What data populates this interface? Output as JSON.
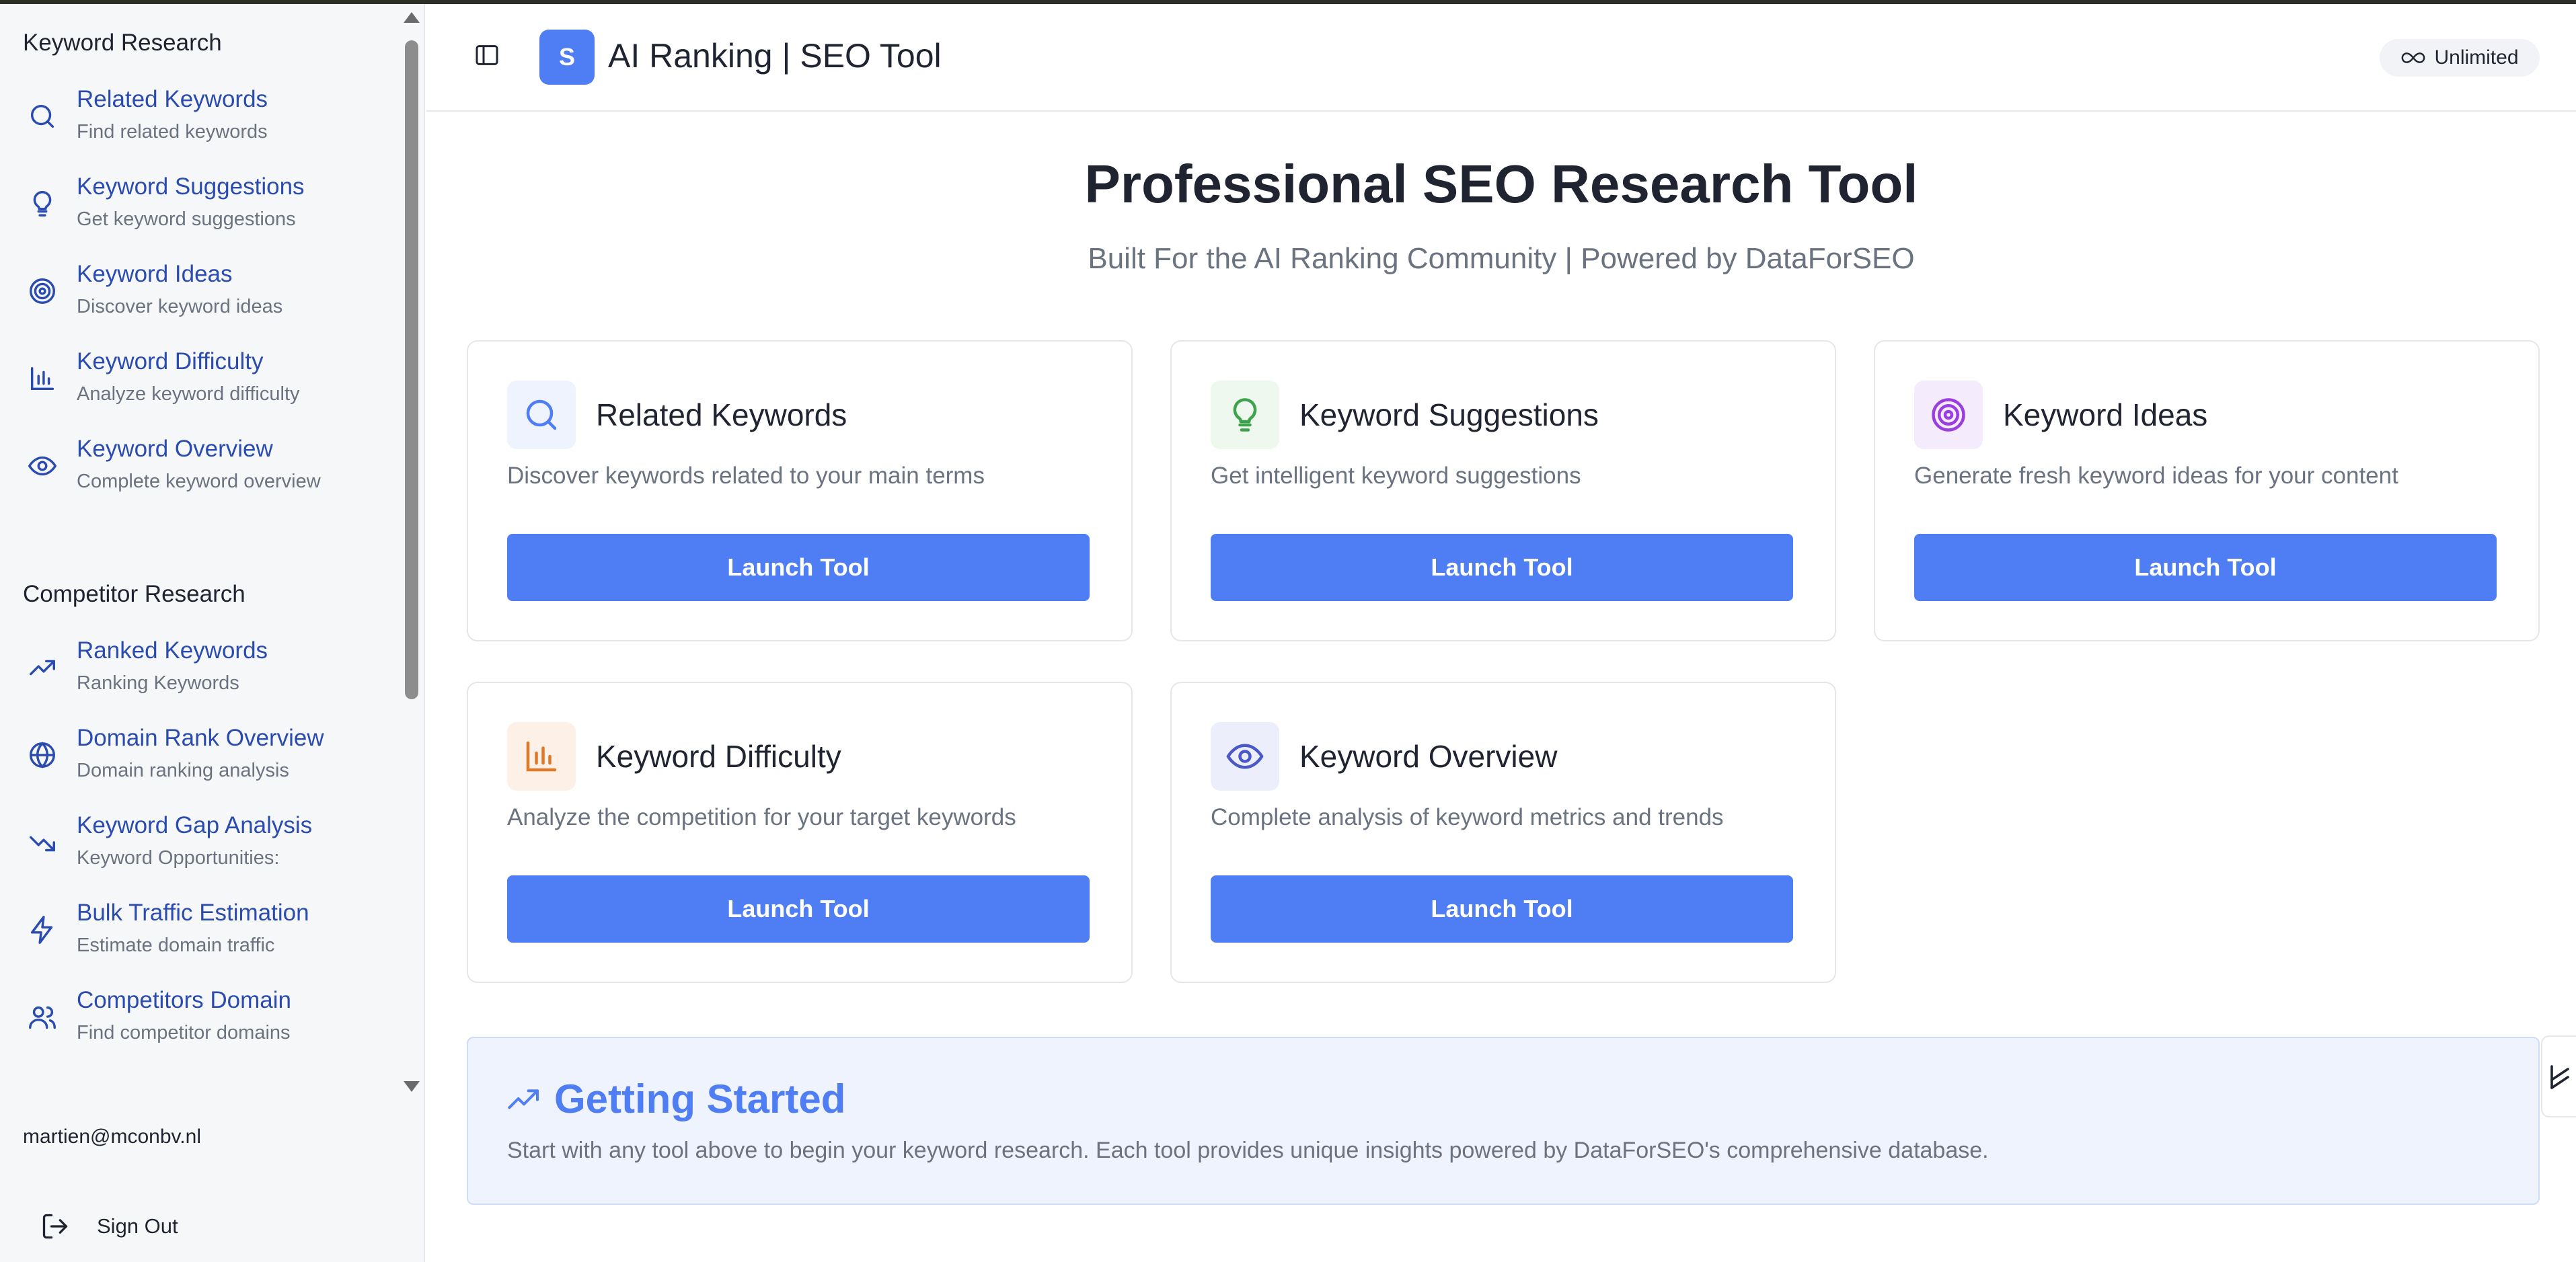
{
  "sidebar": {
    "groups": [
      {
        "title": "Keyword Research",
        "items": [
          {
            "label": "Related Keywords",
            "sub": "Find related keywords",
            "icon": "search-icon"
          },
          {
            "label": "Keyword Suggestions",
            "sub": "Get keyword suggestions",
            "icon": "lightbulb-icon"
          },
          {
            "label": "Keyword Ideas",
            "sub": "Discover keyword ideas",
            "icon": "target-icon"
          },
          {
            "label": "Keyword Difficulty",
            "sub": "Analyze keyword difficulty",
            "icon": "bar-chart-icon"
          },
          {
            "label": "Keyword Overview",
            "sub": "Complete keyword overview",
            "icon": "eye-icon"
          }
        ]
      },
      {
        "title": "Competitor Research",
        "items": [
          {
            "label": "Ranked Keywords",
            "sub": "Ranking Keywords",
            "icon": "trending-up-icon"
          },
          {
            "label": "Domain Rank Overview",
            "sub": "Domain ranking analysis",
            "icon": "globe-icon"
          },
          {
            "label": "Keyword Gap Analysis",
            "sub": "Keyword Opportunities:",
            "icon": "trending-down-icon"
          },
          {
            "label": "Bulk Traffic Estimation",
            "sub": "Estimate domain traffic",
            "icon": "zap-icon"
          },
          {
            "label": "Competitors Domain",
            "sub": "Find competitor domains",
            "icon": "users-icon"
          }
        ]
      }
    ],
    "user_email": "martien@mconbv.nl",
    "sign_out_label": "Sign Out"
  },
  "header": {
    "logo_letter": "S",
    "title": "AI Ranking | SEO Tool",
    "plan_badge": "Unlimited"
  },
  "hero": {
    "title": "Professional SEO Research Tool",
    "subtitle": "Built For the AI Ranking Community | Powered by DataForSEO"
  },
  "cards": [
    {
      "title": "Related Keywords",
      "desc": "Discover keywords related to your main terms",
      "button": "Launch Tool",
      "icon": "search-icon",
      "color": "#4f7df3",
      "bg": "#eef3fd"
    },
    {
      "title": "Keyword Suggestions",
      "desc": "Get intelligent keyword suggestions",
      "button": "Launch Tool",
      "icon": "lightbulb-icon",
      "color": "#3fa34d",
      "bg": "#eef8ee"
    },
    {
      "title": "Keyword Ideas",
      "desc": "Generate fresh keyword ideas for your content",
      "button": "Launch Tool",
      "icon": "target-icon",
      "color": "#9a3ee0",
      "bg": "#f4ecfc"
    },
    {
      "title": "Keyword Difficulty",
      "desc": "Analyze the competition for your target keywords",
      "button": "Launch Tool",
      "icon": "bar-chart-icon",
      "color": "#e0782a",
      "bg": "#fdf1e7"
    },
    {
      "title": "Keyword Overview",
      "desc": "Complete analysis of keyword metrics and trends",
      "button": "Launch Tool",
      "icon": "eye-icon",
      "color": "#4a58c8",
      "bg": "#eceefb"
    }
  ],
  "getting_started": {
    "title": "Getting Started",
    "text": "Start with any tool above to begin your keyword research. Each tool provides unique insights powered by DataForSEO's comprehensive database.",
    "icon": "trending-up-icon"
  },
  "colors": {
    "accent": "#4f7df3",
    "sidebar_link": "#2a4bb0",
    "muted_text": "#6b7280"
  }
}
